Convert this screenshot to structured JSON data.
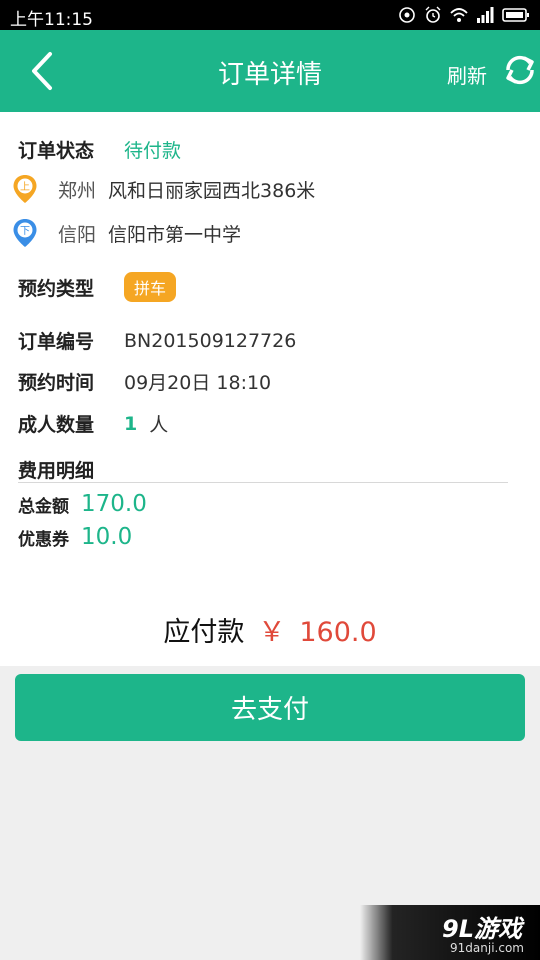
{
  "status_bar": {
    "time": "上午11:15",
    "icons": [
      "cast-icon",
      "alarm-icon",
      "wifi-icon",
      "signal-icon",
      "battery-icon"
    ]
  },
  "app_bar": {
    "title": "订单详情",
    "refresh_label": "刷新",
    "back_icon": "chevron-left-icon",
    "refresh_icon": "refresh-icon"
  },
  "order": {
    "status_label": "订单状态",
    "status_value": "待付款",
    "pickup": {
      "tag": "上",
      "city": "郑州",
      "place": "风和日丽家园西北386米"
    },
    "dropoff": {
      "tag": "下",
      "city": "信阳",
      "place": "信阳市第一中学"
    },
    "type_label": "预约类型",
    "type_value": "拼车",
    "number_label": "订单编号",
    "number_value": "BN201509127726",
    "time_label": "预约时间",
    "time_value": "09月20日 18:10",
    "adults_label": "成人数量",
    "adults_count": "1",
    "adults_unit": "人"
  },
  "fees": {
    "section_label": "费用明细",
    "total_label": "总金额",
    "total_value": "170.0",
    "coupon_label": "优惠券",
    "coupon_value": "10.0"
  },
  "amount_due": {
    "label": "应付款",
    "currency": "￥",
    "value": "160.0"
  },
  "pay_button": {
    "label": "去支付"
  },
  "watermark": {
    "brand": "9L游戏",
    "url": "91danji.com"
  },
  "colors": {
    "primary": "#1db58a",
    "accent_red": "#e0493a",
    "badge_orange": "#f5a623",
    "pin_blue": "#3a8ee6"
  }
}
